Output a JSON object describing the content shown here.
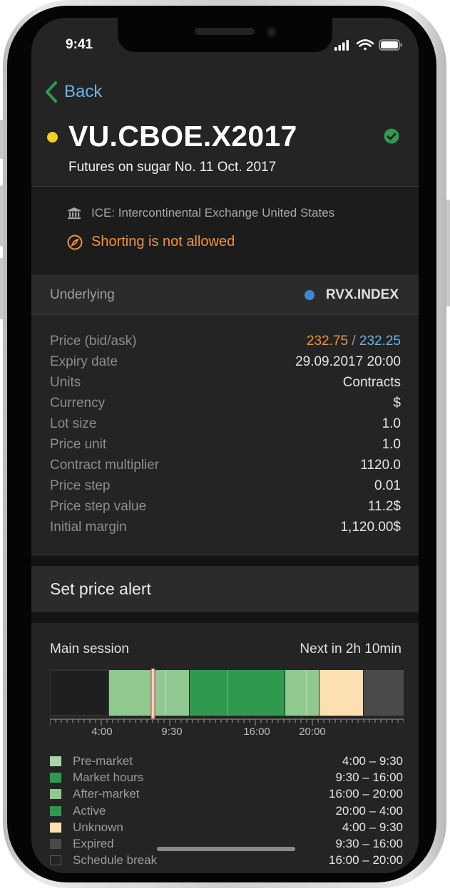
{
  "status_bar": {
    "time": "9:41"
  },
  "nav": {
    "back_label": "Back"
  },
  "instrument": {
    "ticker": "VU.CBOE.X2017",
    "description": "Futures on sugar No. 11 Oct. 2017",
    "exchange": "ICE: Intercontinental Exchange United States",
    "shorting": "Shorting is not allowed"
  },
  "underlying": {
    "label": "Underlying",
    "value": "RVX.INDEX"
  },
  "details": {
    "price_label": "Price (bid/ask)",
    "bid": "232.75",
    "separator": "/",
    "ask": "232.25",
    "rows": [
      {
        "label": "Expiry date",
        "value": "29.09.2017 20:00"
      },
      {
        "label": "Units",
        "value": "Contracts"
      },
      {
        "label": "Currency",
        "value": "$"
      },
      {
        "label": "Lot size",
        "value": "1.0"
      },
      {
        "label": "Price unit",
        "value": "1.0"
      },
      {
        "label": "Contract multiplier",
        "value": "1120.0"
      },
      {
        "label": "Price step",
        "value": "0.01"
      },
      {
        "label": "Price step value",
        "value": "11.2$"
      },
      {
        "label": "Initial margin",
        "value": "1,120.00$"
      }
    ]
  },
  "actions": {
    "alert_label": "Set price alert"
  },
  "session": {
    "label": "Main session",
    "next": "Next in 2h 10min",
    "tick_labels": [
      "4:00",
      "9:30",
      "16:00",
      "20:00"
    ],
    "legend": [
      {
        "name": "Pre-market",
        "range": "4:00 – 9:30",
        "color": "#8fc98f"
      },
      {
        "name": "Market hours",
        "range": "9:30 – 16:00",
        "color": "#2f9a4f"
      },
      {
        "name": "After-market",
        "range": "16:00 – 20:00",
        "color": "#8fc98f"
      },
      {
        "name": "Active",
        "range": "20:00 – 4:00",
        "color": "#2f9a4f"
      },
      {
        "name": "Unknown",
        "range": "4:00 – 9:30",
        "color": "#fde0b2"
      },
      {
        "name": "Expired",
        "range": "9:30 – 16:00",
        "color": "#4a4a4a"
      },
      {
        "name": "Schedule break",
        "range": "16:00 – 20:00",
        "color": "#242424"
      }
    ]
  },
  "colors": {
    "accent_blue": "#6fb3e3",
    "warning_orange": "#f0933c",
    "status_yellow": "#f5cc28",
    "ok_green": "#2f9a4f"
  }
}
